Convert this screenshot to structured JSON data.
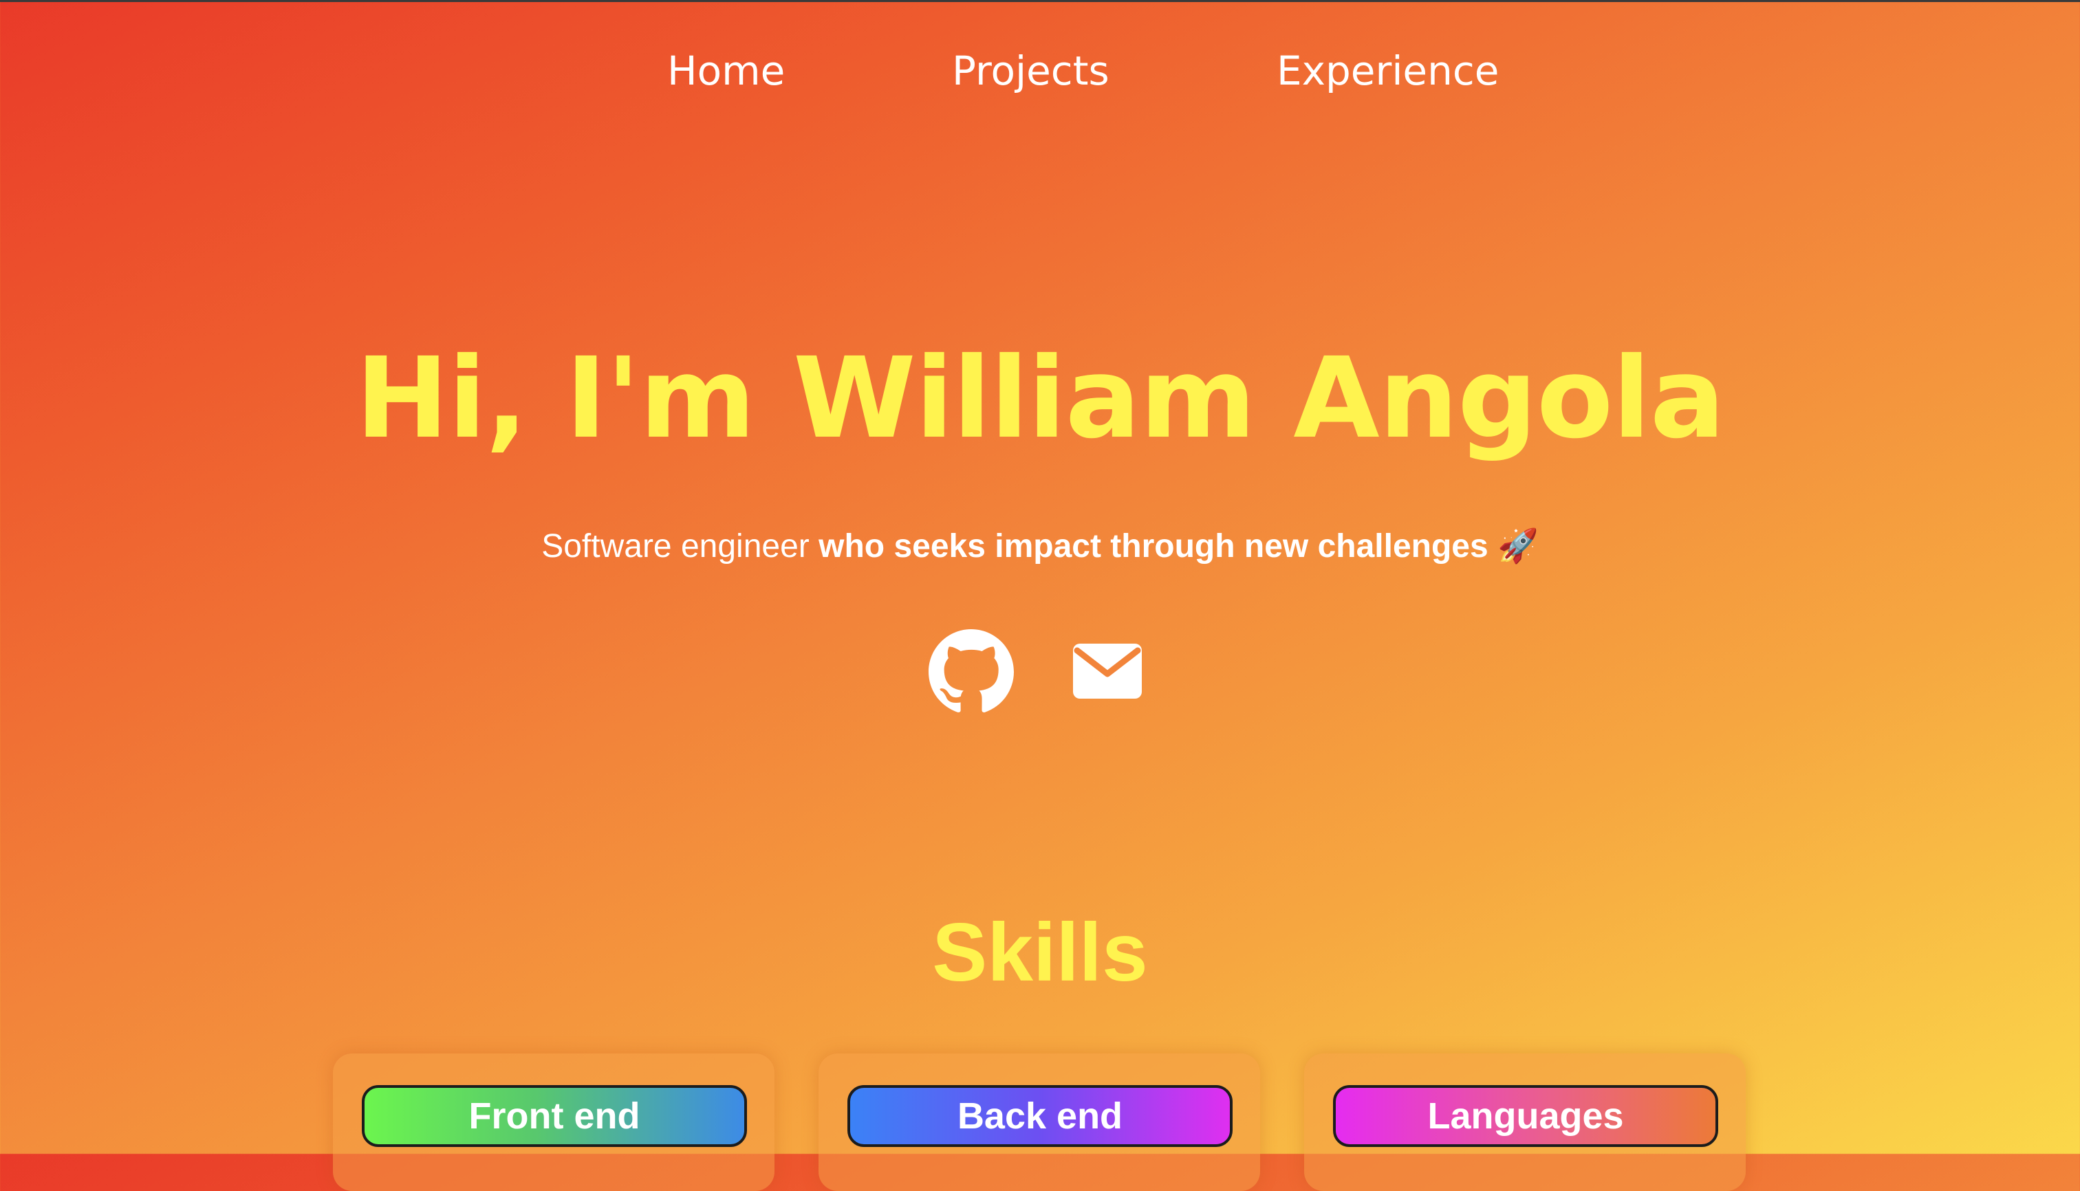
{
  "nav": {
    "items": [
      {
        "label": "Home"
      },
      {
        "label": "Projects"
      },
      {
        "label": "Experience"
      }
    ]
  },
  "hero": {
    "title": "Hi, I'm William Angola",
    "subtitle_plain": "Software engineer ",
    "subtitle_bold": "who seeks impact through new challenges ",
    "subtitle_emoji": "🚀",
    "social": [
      {
        "icon": "github-icon"
      },
      {
        "icon": "mail-icon"
      }
    ]
  },
  "skills": {
    "title": "Skills",
    "categories": [
      {
        "label": "Front end"
      },
      {
        "label": "Back end"
      },
      {
        "label": "Languages"
      }
    ]
  },
  "colors": {
    "heading": "#fff34f",
    "text": "#ffffff",
    "gradient_start": "#e93a29",
    "gradient_end": "#fbd84a"
  }
}
